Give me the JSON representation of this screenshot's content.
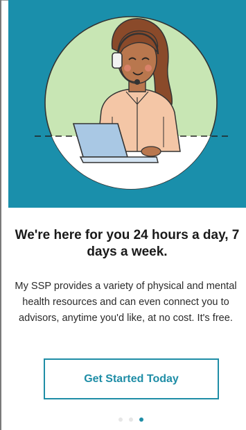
{
  "onboarding": {
    "headline": "We're here for you 24 hours a day, 7 days a week.",
    "body": "My SSP provides a variety of physical and mental health resources and can even connect you to advisors, anytime you'd like, at no cost. It's free.",
    "cta_label": "Get Started Today",
    "pagination": {
      "total": 3,
      "active": 3
    }
  },
  "colors": {
    "hero_background": "#1a8fab",
    "hero_circle": "#c8e6b4",
    "accent": "#1e8da6",
    "skin": "#b9774e",
    "hair": "#8a4a2a",
    "shirt": "#f4c6a6",
    "laptop": "#a9c8e4"
  },
  "icons": {
    "illustration": "support-agent-with-headset-illustration"
  }
}
